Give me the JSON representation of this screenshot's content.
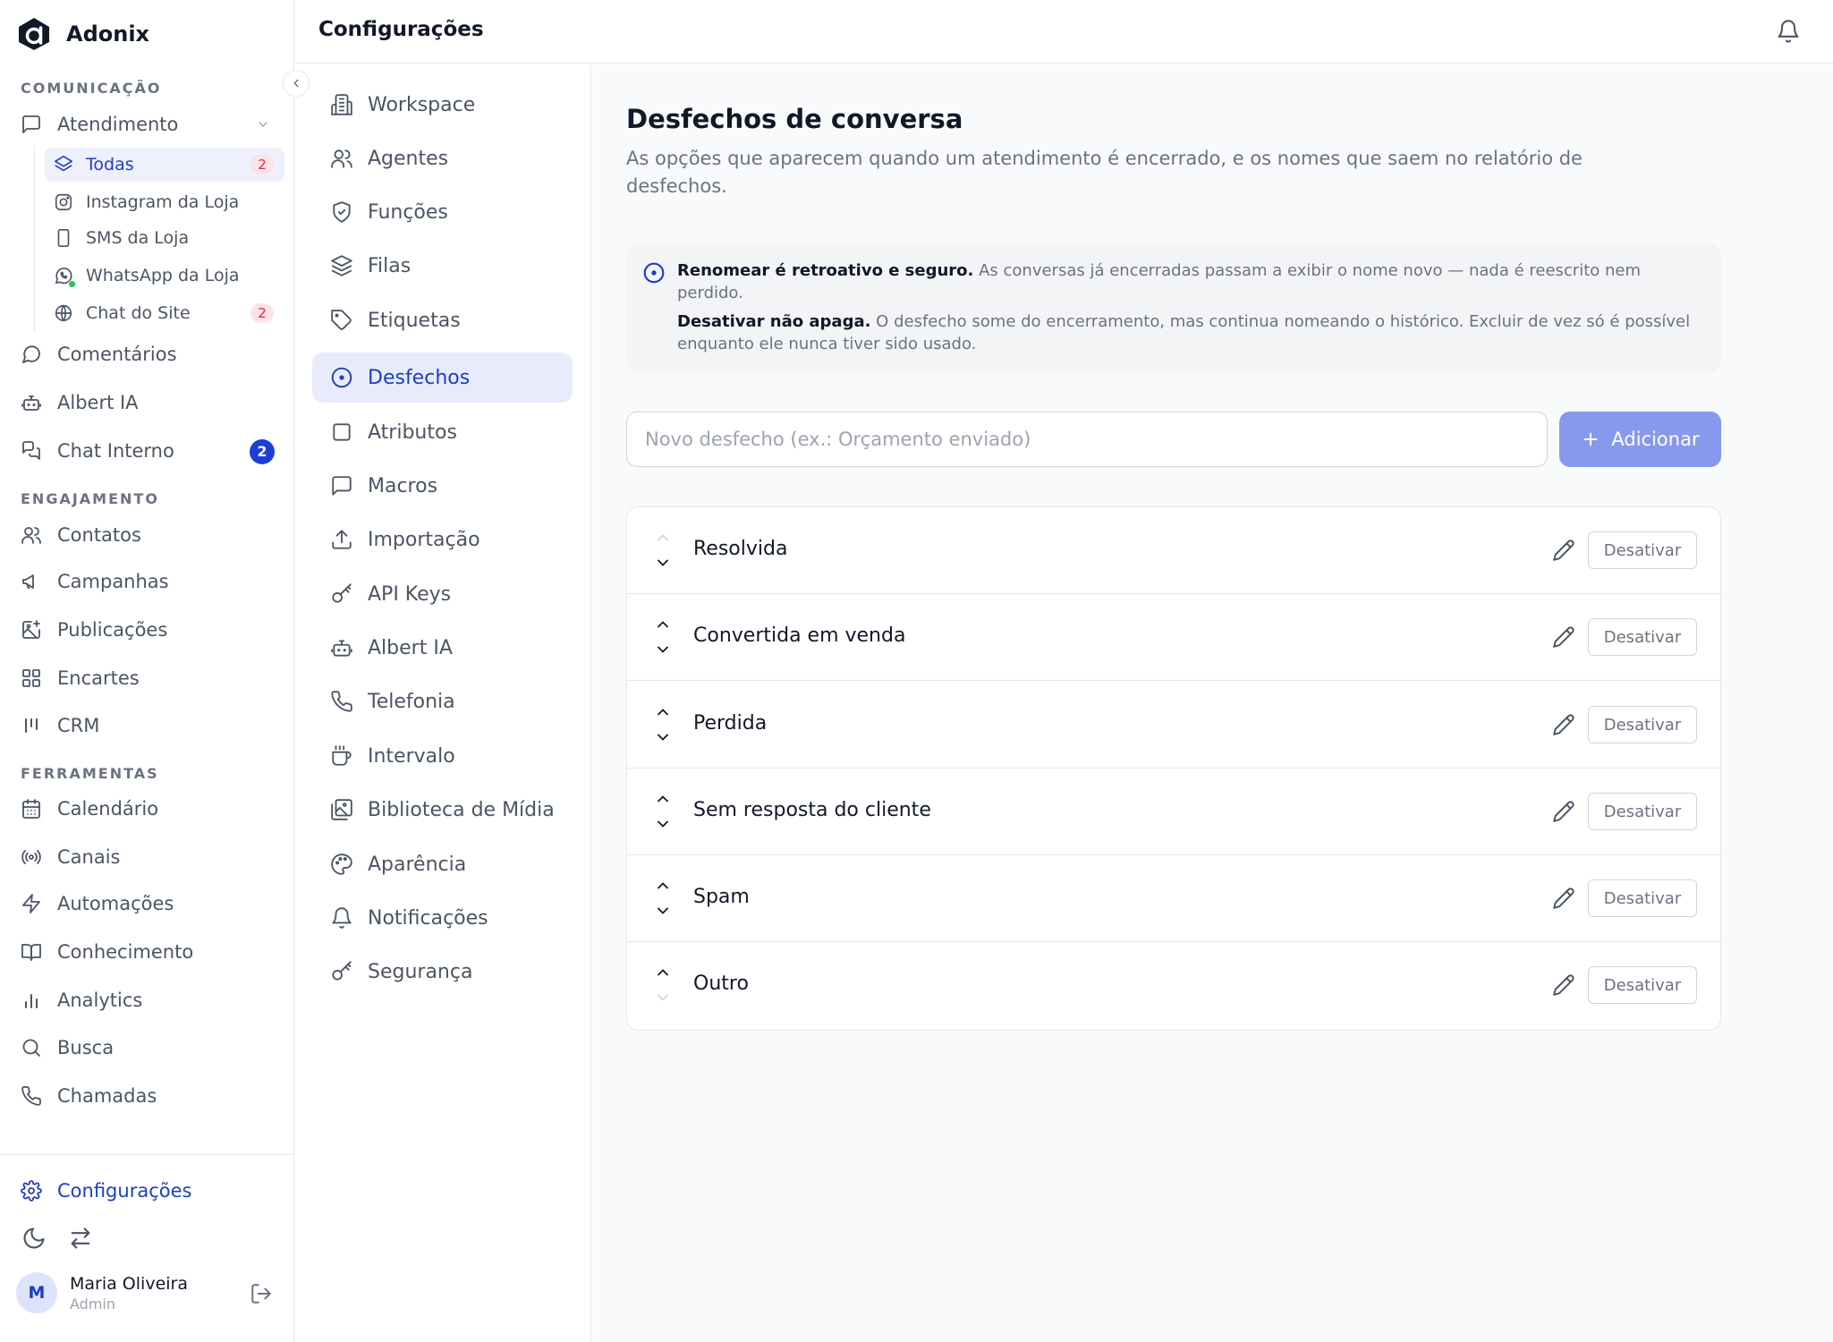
{
  "brand": {
    "name": "Adonix"
  },
  "sidebar": {
    "sections": {
      "comunicacao": "COMUNICAÇÃO",
      "engajamento": "ENGAJAMENTO",
      "ferramentas": "FERRAMENTAS"
    },
    "atendimento": "Atendimento",
    "sub_items": [
      {
        "label": "Todas",
        "badge": "2",
        "icon": "layers-icon"
      },
      {
        "label": "Instagram da Loja",
        "icon": "instagram-icon"
      },
      {
        "label": "SMS da Loja",
        "icon": "phone-device-icon"
      },
      {
        "label": "WhatsApp da Loja",
        "icon": "whatsapp-icon"
      },
      {
        "label": "Chat do Site",
        "badge": "2",
        "icon": "globe-icon"
      }
    ],
    "comunicacao_items": [
      {
        "label": "Comentários",
        "icon": "comment-icon"
      },
      {
        "label": "Albert IA",
        "icon": "bot-icon"
      },
      {
        "label": "Chat Interno",
        "badge": "2",
        "icon": "chat-icon"
      }
    ],
    "engajamento_items": [
      {
        "label": "Contatos",
        "icon": "users-icon"
      },
      {
        "label": "Campanhas",
        "icon": "megaphone-icon"
      },
      {
        "label": "Publicações",
        "icon": "image-plus-icon"
      },
      {
        "label": "Encartes",
        "icon": "grid-icon"
      },
      {
        "label": "CRM",
        "icon": "kanban-icon"
      }
    ],
    "ferramentas_items": [
      {
        "label": "Calendário",
        "icon": "calendar-icon"
      },
      {
        "label": "Canais",
        "icon": "radio-icon"
      },
      {
        "label": "Automações",
        "icon": "zap-icon"
      },
      {
        "label": "Conhecimento",
        "icon": "book-icon"
      },
      {
        "label": "Analytics",
        "icon": "bar-chart-icon"
      },
      {
        "label": "Busca",
        "icon": "search-icon"
      },
      {
        "label": "Chamadas",
        "icon": "phone-icon"
      }
    ],
    "settings": "Configurações",
    "user": {
      "initial": "M",
      "name": "Maria Oliveira",
      "role": "Admin"
    }
  },
  "header": {
    "title": "Configurações"
  },
  "settings_nav": [
    {
      "label": "Workspace",
      "icon": "building-icon"
    },
    {
      "label": "Agentes",
      "icon": "users-icon"
    },
    {
      "label": "Funções",
      "icon": "shield-icon"
    },
    {
      "label": "Filas",
      "icon": "layers-icon"
    },
    {
      "label": "Etiquetas",
      "icon": "tag-icon"
    },
    {
      "label": "Desfechos",
      "icon": "target-icon",
      "active": true
    },
    {
      "label": "Atributos",
      "icon": "square-icon"
    },
    {
      "label": "Macros",
      "icon": "message-square-icon"
    },
    {
      "label": "Importação",
      "icon": "upload-icon"
    },
    {
      "label": "API Keys",
      "icon": "key-icon"
    },
    {
      "label": "Albert IA",
      "icon": "bot-icon"
    },
    {
      "label": "Telefonia",
      "icon": "phone-icon"
    },
    {
      "label": "Intervalo",
      "icon": "coffee-icon"
    },
    {
      "label": "Biblioteca de Mídia",
      "icon": "images-icon"
    },
    {
      "label": "Aparência",
      "icon": "palette-icon"
    },
    {
      "label": "Notificações",
      "icon": "bell-icon"
    },
    {
      "label": "Segurança",
      "icon": "key-icon"
    }
  ],
  "main": {
    "title": "Desfechos de conversa",
    "description": "As opções que aparecem quando um atendimento é encerrado, e os nomes que saem no relatório de desfechos.",
    "info": {
      "line1_bold": "Renomear é retroativo e seguro.",
      "line1_text": " As conversas já encerradas passam a exibir o nome novo — nada é reescrito nem perdido.",
      "line2_bold": "Desativar não apaga.",
      "line2_text": " O desfecho some do encerramento, mas continua nomeando o histórico. Excluir de vez só é possível enquanto ele nunca tiver sido usado."
    },
    "new_placeholder": "Novo desfecho (ex.: Orçamento enviado)",
    "add_label": "Adicionar",
    "outcomes": [
      {
        "label": "Resolvida",
        "action": "Desativar"
      },
      {
        "label": "Convertida em venda",
        "action": "Desativar"
      },
      {
        "label": "Perdida",
        "action": "Desativar"
      },
      {
        "label": "Sem resposta do cliente",
        "action": "Desativar"
      },
      {
        "label": "Spam",
        "action": "Desativar"
      },
      {
        "label": "Outro",
        "action": "Desativar"
      }
    ]
  },
  "colors": {
    "accent": "#1d3fbf",
    "accent_soft": "#e8ebfb",
    "button": "#8799ec",
    "badge_pink": "#dc2646"
  }
}
